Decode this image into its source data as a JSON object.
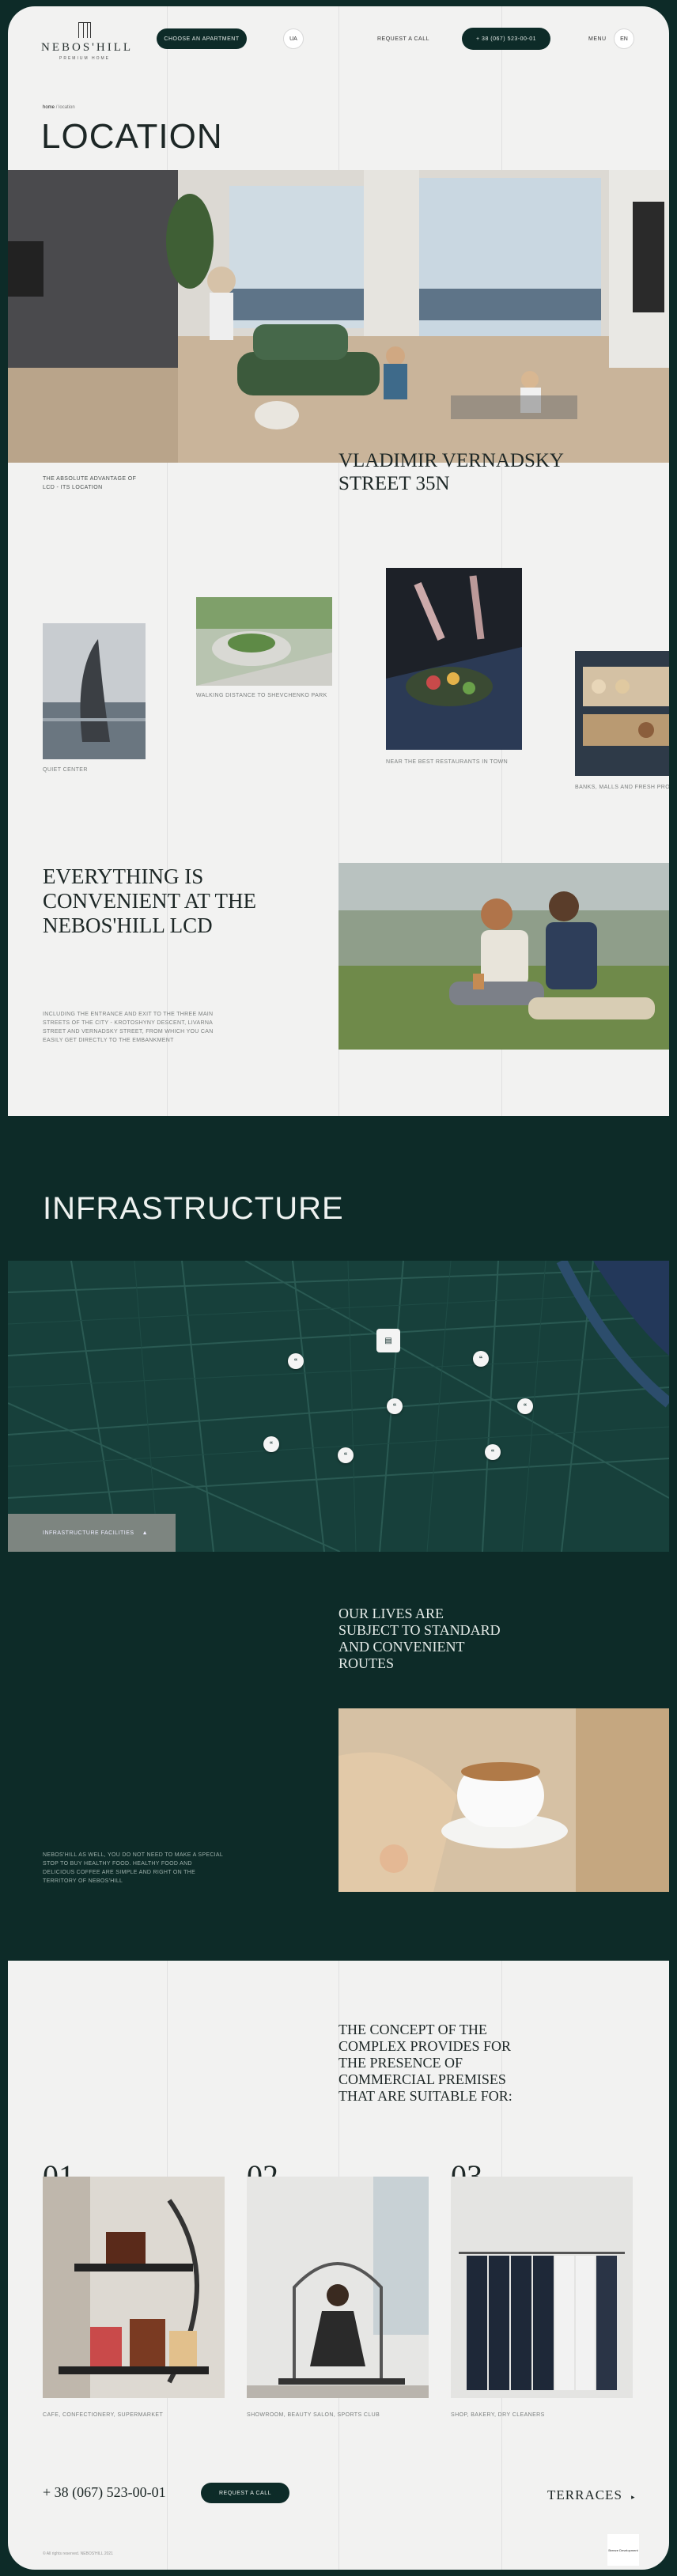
{
  "header": {
    "logo_name": "NEBOS'HILL",
    "logo_sub": "PREMIUM HOME",
    "choose_btn": "CHOOSE AN APARTMENT",
    "lang": "UA",
    "request_call": "REQUEST A CALL",
    "phone_btn": "+ 38 (067) 523-00-01",
    "menu": "MENU",
    "menu_lang": "EN"
  },
  "breadcrumb": {
    "home": "home",
    "sep": "/",
    "current": "location"
  },
  "page_title": "LOCATION",
  "location": {
    "label": "THE ABSOLUTE ADVANTAGE OF LCD - ITS LOCATION",
    "address": "VLADIMIR VERNADSKY STREET 35N",
    "captions": [
      "QUIET CENTER",
      "WALKING DISTANCE TO SHEVCHENKO PARK",
      "NEAR THE BEST RESTAURANTS IN TOWN",
      "BANKS, MALLS AND FRESH PRODUCE"
    ]
  },
  "convenient": {
    "title": "EVERYTHING IS CONVENIENT AT THE NEBOS'HILL LCD",
    "text": "INCLUDING THE ENTRANCE AND EXIT TO THE THREE MAIN STREETS OF THE CITY - KROTOSHYNY DESCENT, LIVARNA STREET AND VERNADSKY STREET, FROM WHICH YOU CAN EASILY GET DIRECTLY TO THE EMBANKMENT"
  },
  "infrastructure": {
    "title": "INFRASTRUCTURE",
    "filter_btn": "INFRASTRUCTURE FACILITIES",
    "lives_title": "OUR LIVES ARE SUBJECT TO STANDARD AND CONVENIENT ROUTES",
    "lives_text": "NEBOS'HILL AS WELL, YOU DO NOT NEED TO MAKE A SPECIAL STOP TO BUY HEALTHY FOOD. HEALTHY FOOD AND DELICIOUS COFFEE ARE SIMPLE AND RIGHT ON THE TERRITORY OF NEBOS'HILL"
  },
  "concept": {
    "title": "THE CONCEPT OF THE COMPLEX PROVIDES FOR THE PRESENCE OF COMMERCIAL PREMISES THAT ARE SUITABLE FOR:",
    "items": [
      {
        "num": "01",
        "caption": "CAFE, CONFECTIONERY, SUPERMARKET"
      },
      {
        "num": "02",
        "caption": "SHOWROOM, BEAUTY SALON, SPORTS CLUB"
      },
      {
        "num": "03",
        "caption": "SHOP, BAKERY, DRY CLEANERS"
      }
    ]
  },
  "footer": {
    "phone": "+ 38 (067) 523-00-01",
    "request_btn": "REQUEST A CALL",
    "next_label": "TERRACES",
    "copyright": "© All rights reserved. NEBOS'HILL 2021",
    "badge": "Breeze Development"
  },
  "colors": {
    "dark": "#0d2b28",
    "sheet": "#f2f2f1"
  }
}
